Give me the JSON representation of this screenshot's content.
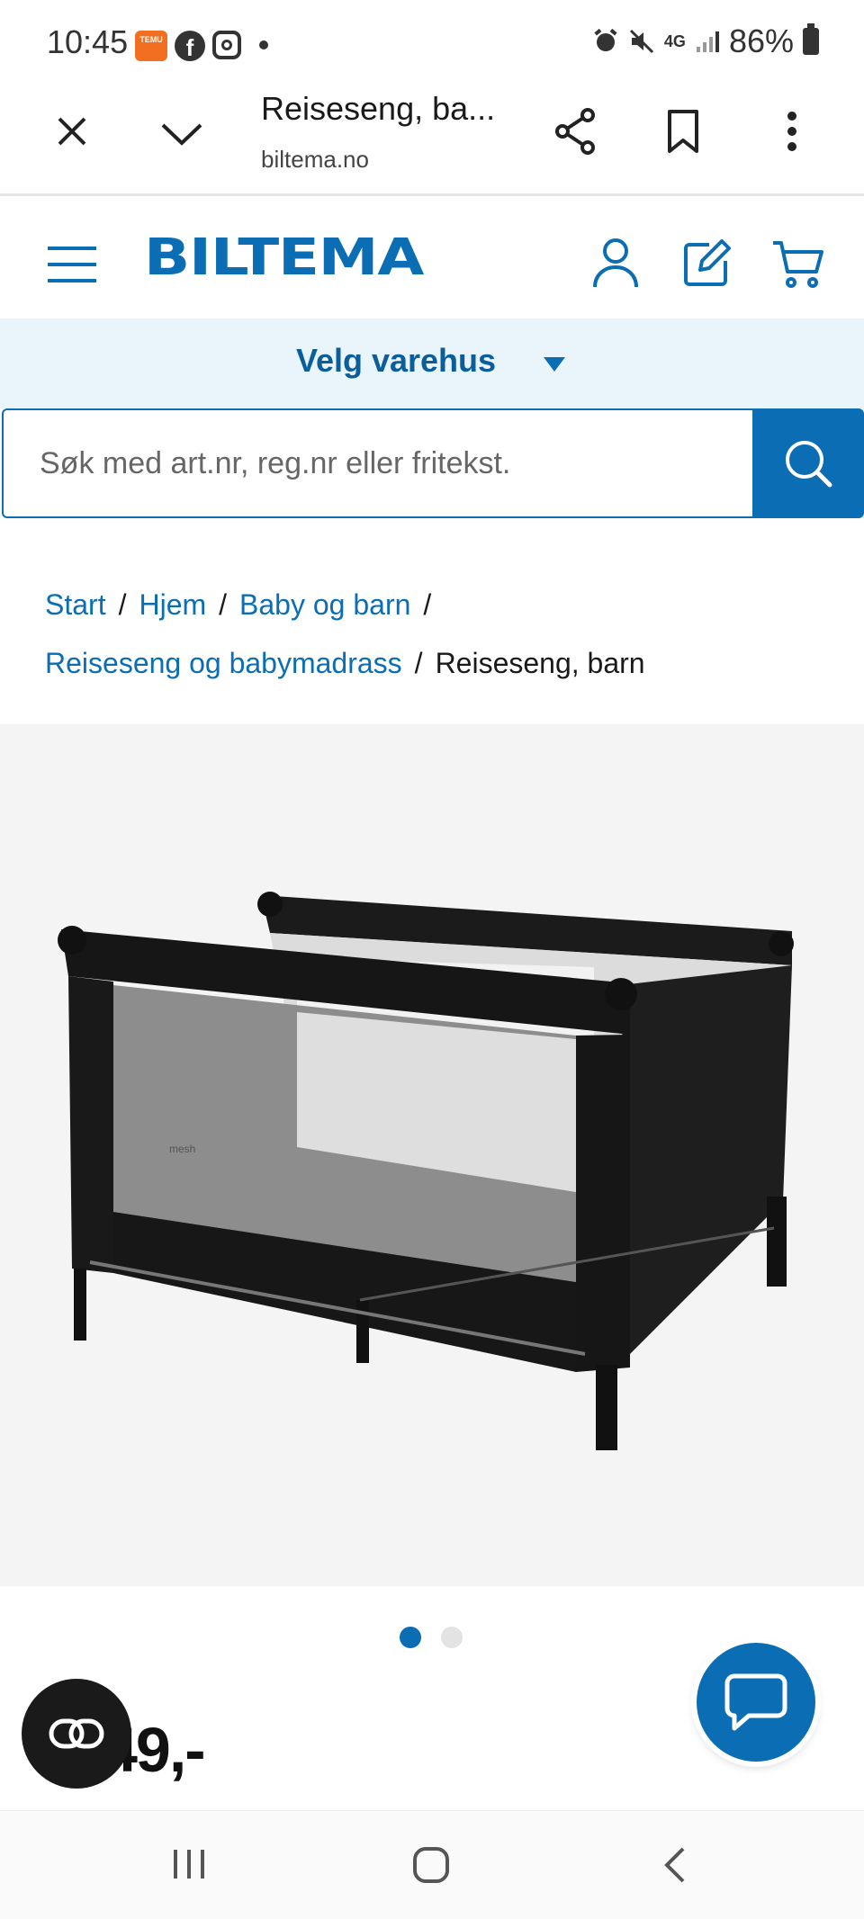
{
  "status_bar": {
    "time": "10:45",
    "temu_text": "TEMU",
    "network": "4G",
    "battery": "86%"
  },
  "browser": {
    "tab_title": "Reiseseng, ba...",
    "url": "biltema.no"
  },
  "header": {
    "logo": "BILTEMA",
    "brand_color": "#0b6eb5"
  },
  "store_selector": {
    "label": "Velg varehus"
  },
  "search": {
    "placeholder": "Søk med art.nr, reg.nr eller fritekst."
  },
  "breadcrumbs": {
    "items": [
      "Start",
      "Hjem",
      "Baby og barn",
      "Reiseseng og babymadrass"
    ],
    "current": "Reiseseng, barn",
    "separator": "/"
  },
  "product": {
    "image_icon": "travel-cot-image",
    "mesh_label": "mesh",
    "carousel_active": 1,
    "carousel_total": 2,
    "price_visible": "49,-"
  },
  "colors": {
    "accent": "#0b6eb5",
    "store_bg": "#e9f4fb",
    "image_bg": "#f4f4f4"
  }
}
